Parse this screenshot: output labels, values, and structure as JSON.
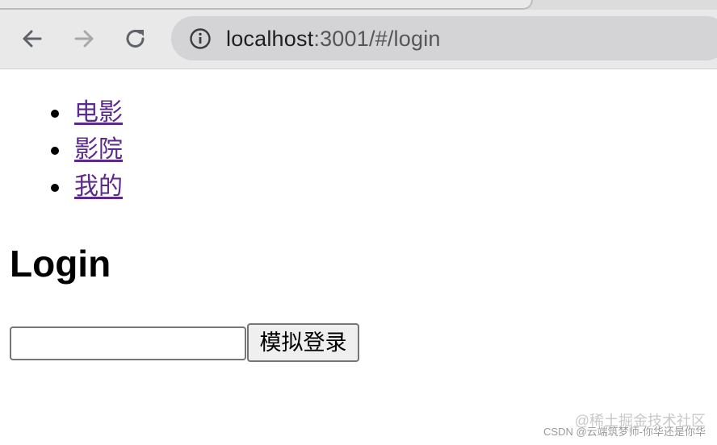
{
  "browser": {
    "url_host": "localhost",
    "url_path": ":3001/#/login",
    "icons": {
      "back": "back-arrow-icon",
      "forward": "forward-arrow-icon",
      "reload": "reload-icon",
      "info": "info-icon"
    }
  },
  "nav": {
    "items": [
      {
        "label": "电影"
      },
      {
        "label": "影院"
      },
      {
        "label": "我的"
      }
    ]
  },
  "page": {
    "title": "Login",
    "input_value": "",
    "login_button": "模拟登录"
  },
  "watermark": {
    "line1": "@稀土掘金技术社区",
    "line2": "CSDN @云端筑梦师-你华还是你华"
  },
  "colors": {
    "link": "#5c2a8f",
    "chrome": "#e9e9ea",
    "omnibox": "#d4d4d6"
  }
}
